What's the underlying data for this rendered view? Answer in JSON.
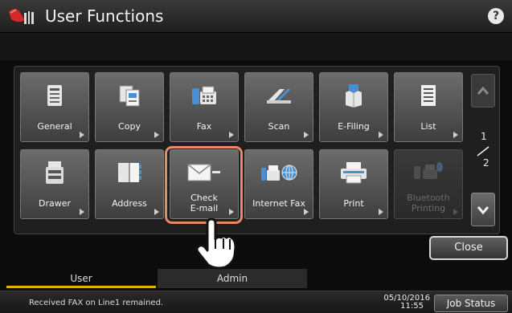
{
  "header": {
    "title": "User Functions",
    "help_label": "?"
  },
  "tiles": [
    {
      "label": "General",
      "icon": "general-icon",
      "enabled": true
    },
    {
      "label": "Copy",
      "icon": "copy-icon",
      "enabled": true
    },
    {
      "label": "Fax",
      "icon": "fax-icon",
      "enabled": true
    },
    {
      "label": "Scan",
      "icon": "scan-icon",
      "enabled": true
    },
    {
      "label": "E-Filing",
      "icon": "e-filing-icon",
      "enabled": true
    },
    {
      "label": "List",
      "icon": "list-icon",
      "enabled": true
    },
    {
      "label": "Drawer",
      "icon": "drawer-icon",
      "enabled": true
    },
    {
      "label": "Address",
      "icon": "address-book-icon",
      "enabled": true
    },
    {
      "label": "Check\nE-mail",
      "icon": "envelope-icon",
      "enabled": true
    },
    {
      "label": "Internet Fax",
      "icon": "internet-fax-icon",
      "enabled": true
    },
    {
      "label": "Print",
      "icon": "printer-icon",
      "enabled": true
    },
    {
      "label": "Bluetooth\nPrinting",
      "icon": "bluetooth-printing-icon",
      "enabled": false
    }
  ],
  "pager": {
    "current": "1",
    "total": "2"
  },
  "close_label": "Close",
  "tabs": {
    "user": "User",
    "admin": "Admin"
  },
  "status": {
    "message": "Received FAX on Line1 remained.",
    "date": "05/10/2016",
    "time": "11:55",
    "job_status_label": "Job Status"
  },
  "colors": {
    "highlight": "#e98967",
    "active_tab_underline": "#d9b500"
  }
}
